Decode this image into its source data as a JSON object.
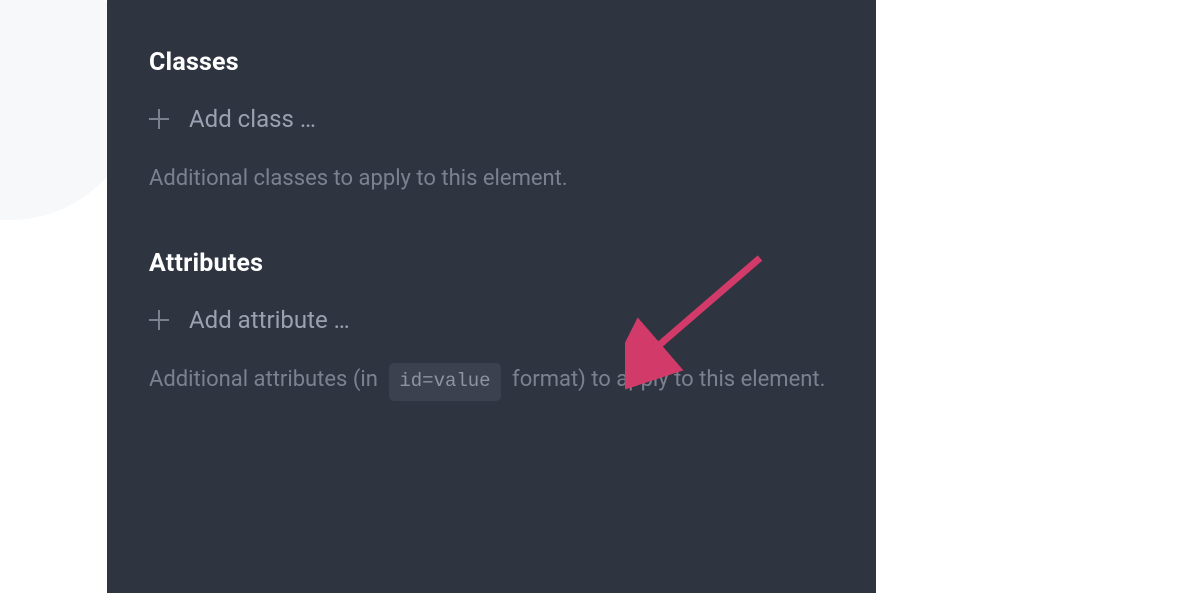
{
  "sections": {
    "classes": {
      "title": "Classes",
      "add_label": "Add class …",
      "help": "Additional classes to apply to this element."
    },
    "attributes": {
      "title": "Attributes",
      "add_label": "Add attribute …",
      "help_before": "Additional attributes (in",
      "help_code": "id=value",
      "help_after": "format) to apply to this element."
    }
  },
  "colors": {
    "panel_bg": "#2e3440",
    "arrow": "#d23a69"
  }
}
